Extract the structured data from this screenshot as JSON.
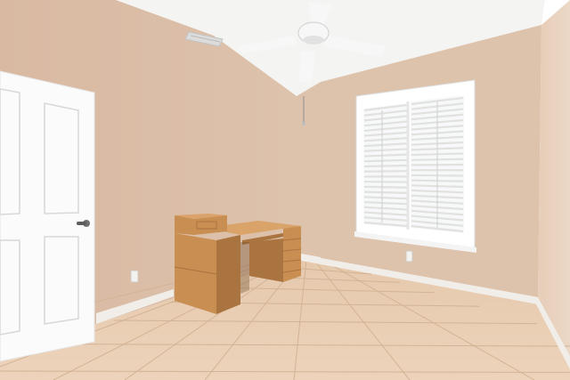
{
  "colors": {
    "ceiling": "#f4f4f2",
    "wall_left": "#d9b9a2",
    "wall_back": "#ddc2ac",
    "wall_right": "#e6cdb8",
    "floor": "#e6c9ad",
    "grout": "#d3b395",
    "baseboard": "#f1eeea",
    "door": "#fbfbfb",
    "door_panel_line": "#d8d8d8",
    "window_frame": "#ffffff",
    "shutter_slat": "#e1e1df",
    "glass_glow": "#f7f8f9",
    "desk_wood": "#c98e52",
    "desk_wood_dark": "#a9743f",
    "desk_wood_light": "#d9a36a",
    "fan_white": "#f7f7f7",
    "fan_shadow": "#c9c9c9",
    "outlet": "#f2f2f0"
  }
}
